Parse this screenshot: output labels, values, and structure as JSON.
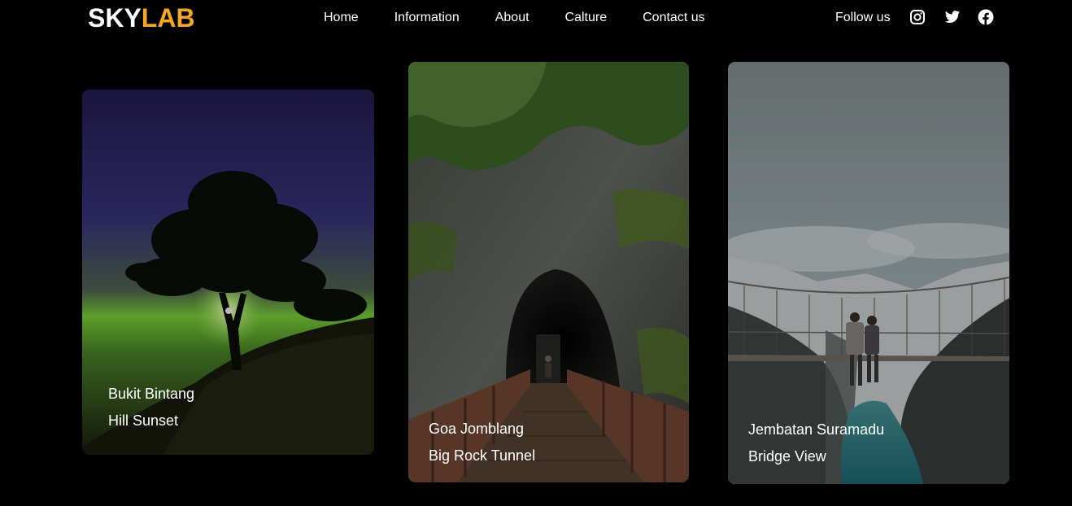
{
  "brand": {
    "part1": "SKY",
    "part2": "LAB",
    "accent": "#f5a623"
  },
  "nav": {
    "items": [
      "Home",
      "Information",
      "About",
      "Calture",
      "Contact us"
    ]
  },
  "social": {
    "label": "Follow us",
    "icons": [
      "instagram-icon",
      "twitter-icon",
      "facebook-icon"
    ]
  },
  "cards": [
    {
      "line1": "Bukit Bintang",
      "line2": "Hill Sunset"
    },
    {
      "line1": "Goa Jomblang",
      "line2": "Big Rock Tunnel"
    },
    {
      "line1": "Jembatan Suramadu",
      "line2": "Bridge View"
    }
  ]
}
